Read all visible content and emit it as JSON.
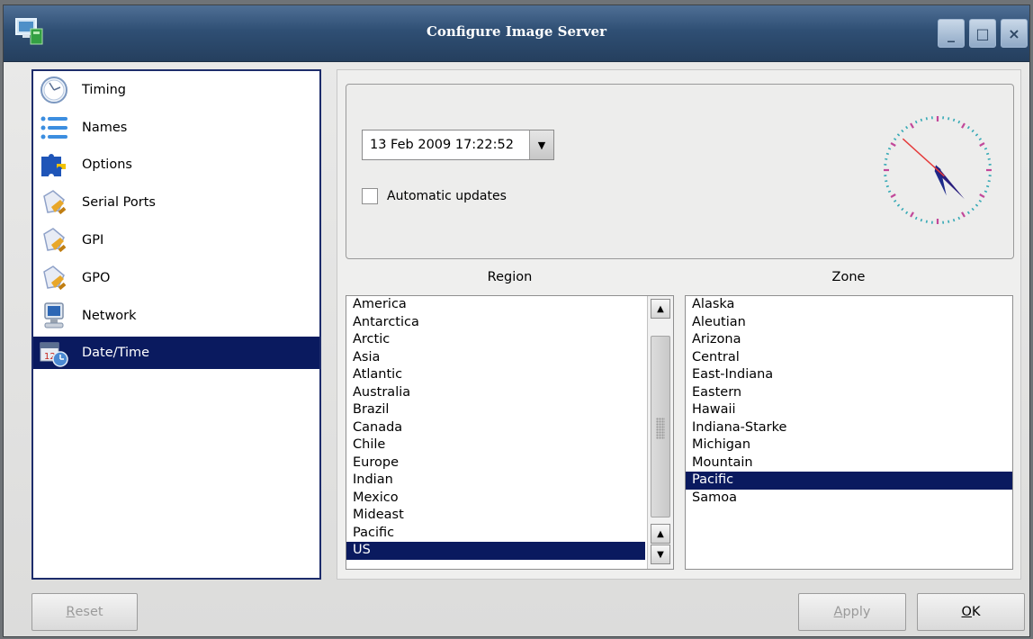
{
  "window": {
    "title": "Configure Image Server",
    "controls": {
      "minimize": "_",
      "maximize": "□",
      "close": "×"
    }
  },
  "sidebar": {
    "items": [
      {
        "label": "Timing",
        "icon": "clock-icon"
      },
      {
        "label": "Names",
        "icon": "list-icon"
      },
      {
        "label": "Options",
        "icon": "puzzle-icon"
      },
      {
        "label": "Serial Ports",
        "icon": "plug-icon"
      },
      {
        "label": "GPI",
        "icon": "plug-icon"
      },
      {
        "label": "GPO",
        "icon": "plug-icon"
      },
      {
        "label": "Network",
        "icon": "monitor-icon"
      },
      {
        "label": "Date/Time",
        "icon": "calendar-clock-icon",
        "selected": true
      }
    ]
  },
  "datetime": {
    "value": "13 Feb 2009 17:22:52",
    "auto_updates_label": "Automatic updates",
    "auto_updates_checked": false,
    "clock_time": "17:22:52"
  },
  "region": {
    "label": "Region",
    "items": [
      "America",
      "Antarctica",
      "Arctic",
      "Asia",
      "Atlantic",
      "Australia",
      "Brazil",
      "Canada",
      "Chile",
      "Europe",
      "Indian",
      "Mexico",
      "Mideast",
      "Pacific",
      "US"
    ],
    "selected": "US"
  },
  "zone": {
    "label": "Zone",
    "items": [
      "Alaska",
      "Aleutian",
      "Arizona",
      "Central",
      "East-Indiana",
      "Eastern",
      "Hawaii",
      "Indiana-Starke",
      "Michigan",
      "Mountain",
      "Pacific",
      "Samoa"
    ],
    "selected": "Pacific"
  },
  "buttons": {
    "reset": {
      "label": "Reset",
      "mnemonic": "R",
      "rest": "eset",
      "enabled": false
    },
    "apply": {
      "label": "Apply",
      "mnemonic": "A",
      "rest": "pply",
      "enabled": false
    },
    "ok": {
      "label": "OK",
      "mnemonic": "O",
      "rest": "K",
      "enabled": true
    }
  },
  "colors": {
    "titlebar": "#2f4f74",
    "selection": "#0a1a5f",
    "nav_border": "#1d2c6b"
  }
}
